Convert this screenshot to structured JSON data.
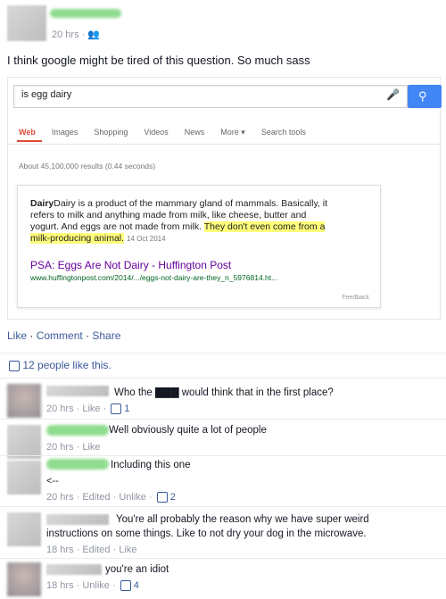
{
  "post": {
    "time": "20 hrs",
    "text": "I think google might be tired of this question. So much sass"
  },
  "google": {
    "query": "is egg dairy",
    "tabs": [
      "Web",
      "Images",
      "Shopping",
      "Videos",
      "News",
      "More ▾",
      "Search tools"
    ],
    "results_count": "About 45,100,000 results (0.44 seconds)",
    "answer_line1": "Dairy is a product of the mammary gland of mammals. Basically, it",
    "answer_line2": "refers to milk and anything made from milk, like cheese, butter and",
    "answer_line3_a": "yogurt. And eggs are not made from milk. ",
    "answer_line3_hl": "They don't even come from a",
    "answer_line4_hl": "milk-producing animal.",
    "answer_date": "14 Oct 2014",
    "result_title": "PSA: Eggs Are Not Dairy - Huffington Post",
    "result_url": "www.huffingtonpost.com/2014/.../eggs-not-dairy-are-they_n_5976814.ht...",
    "feedback": "Feedback"
  },
  "actions": {
    "like": "Like",
    "comment": "Comment",
    "share": "Share"
  },
  "likes": "12 people like this.",
  "comments": [
    {
      "text": "Who the ▇▇▇ would think that in the first place?",
      "meta": "20 hrs · Like · ",
      "likes": "1"
    },
    {
      "text": "Well obviously quite a lot of people",
      "meta": "20 hrs · Like",
      "likes": ""
    },
    {
      "text": "Including this one",
      "text2": "<--",
      "meta": "20 hrs · Edited · Unlike · ",
      "likes": "2"
    },
    {
      "text": "You're all probably the reason why we have super weird",
      "text2": "instructions on some things. Like to not dry your dog in the microwave.",
      "meta": "18 hrs · Edited · Like",
      "likes": ""
    },
    {
      "text": "you're an idiot",
      "meta": "18 hrs · Unlike · ",
      "likes": "4"
    }
  ]
}
